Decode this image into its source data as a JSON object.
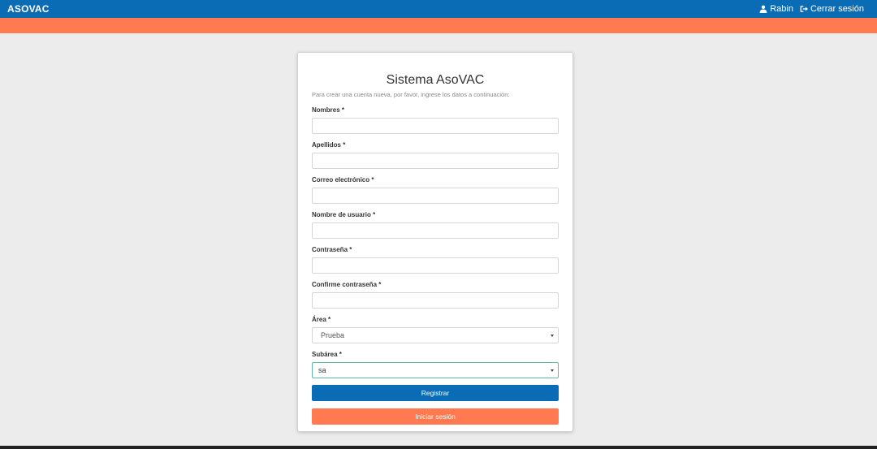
{
  "header": {
    "brand": "ASOVAC",
    "user_label": "Rabin",
    "logout_label": "Cerrar sesión",
    "user_icon": "user-icon",
    "logout_icon": "sign-out-icon",
    "color": "#0a6cb5"
  },
  "accent_color": "#ff7a50",
  "form": {
    "title": "Sistema AsoVAC",
    "subtitle": "Para crear una cuenta nueva, por favor, ingrese los datos a continuación:",
    "fields": [
      {
        "label": "Nombres *",
        "value": ""
      },
      {
        "label": "Apellidos *",
        "value": ""
      },
      {
        "label": "Correo electrónico *",
        "value": ""
      },
      {
        "label": "Nombre de usuario *",
        "value": ""
      },
      {
        "label": "Contraseña *",
        "value": ""
      },
      {
        "label": "Confirme contraseña *",
        "value": ""
      }
    ],
    "area": {
      "label": "Área *",
      "selected": "Prueba"
    },
    "subarea": {
      "label": "Subárea *",
      "selected": "sa"
    },
    "register_label": "Registrar",
    "login_label": "Iniciar sesión"
  }
}
